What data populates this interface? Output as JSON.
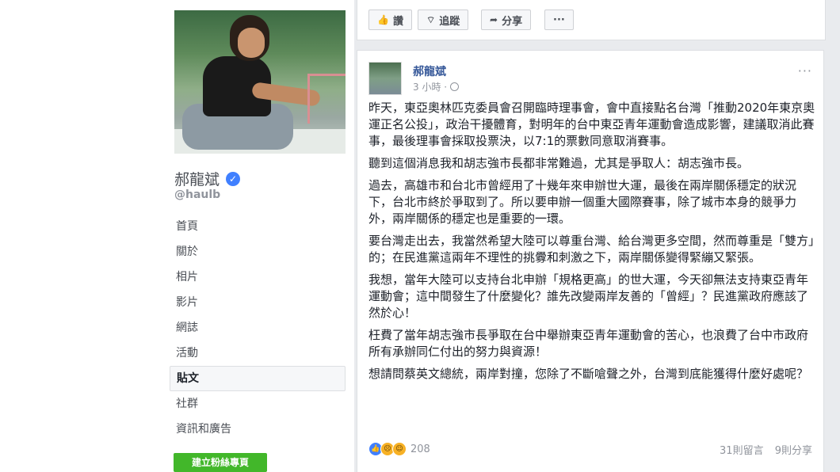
{
  "profile": {
    "name": "郝龍斌",
    "handle": "@haulb",
    "verified": true,
    "nav": [
      {
        "label": "首頁",
        "active": false
      },
      {
        "label": "關於",
        "active": false
      },
      {
        "label": "相片",
        "active": false
      },
      {
        "label": "影片",
        "active": false
      },
      {
        "label": "網誌",
        "active": false
      },
      {
        "label": "活動",
        "active": false
      },
      {
        "label": "貼文",
        "active": true
      },
      {
        "label": "社群",
        "active": false
      },
      {
        "label": "資訊和廣告",
        "active": false
      }
    ],
    "create_page_label": "建立粉絲專頁"
  },
  "actions": {
    "like": "讚",
    "follow": "追蹤",
    "share": "分享",
    "more": "···"
  },
  "post": {
    "author": "郝龍斌",
    "time": "3 小時 ·",
    "more": "···",
    "paragraphs": [
      "昨天，東亞奧林匹克委員會召開臨時理事會，會中直接點名台灣「推動2020年東京奧運正名公投」，政治干擾體育，對明年的台中東亞青年運動會造成影響，建議取消此賽事，最後理事會採取投票決，以7:1的票數同意取消賽事。",
      "聽到這個消息我和胡志強市長都非常難過，尤其是爭取人：胡志強市長。",
      "過去，高雄市和台北市曾經用了十幾年來申辦世大運，最後在兩岸關係穩定的狀況下，台北市終於爭取到了。所以要申辦一個重大國際賽事，除了城市本身的競爭力外，兩岸關係的穩定也是重要的一環。",
      "要台灣走出去，我當然希望大陸可以尊重台灣、給台灣更多空間，然而尊重是「雙方」的；在民進黨這兩年不理性的挑釁和刺激之下，兩岸關係變得緊繃又緊張。",
      "我想，當年大陸可以支持台北申辦「規格更高」的世大運，今天卻無法支持東亞青年運動會；這中間發生了什麼變化？誰先改變兩岸友善的「曾經」？民進黨政府應該了然於心！",
      "枉費了當年胡志強市長爭取在台中舉辦東亞青年運動會的苦心，也浪費了台中市政府所有承辦同仁付出的努力與資源！",
      "想請問蔡英文總統，兩岸對撞，您除了不斷嗆聲之外，台灣到底能獲得什麼好處呢？"
    ],
    "reactions_count": "208",
    "comments": "31則留言",
    "shares": "9則分享"
  },
  "colors": {
    "link": "#365899",
    "create_button": "#42b72a",
    "verified_badge": "#4080ff",
    "feed_background": "#e9ebee"
  }
}
